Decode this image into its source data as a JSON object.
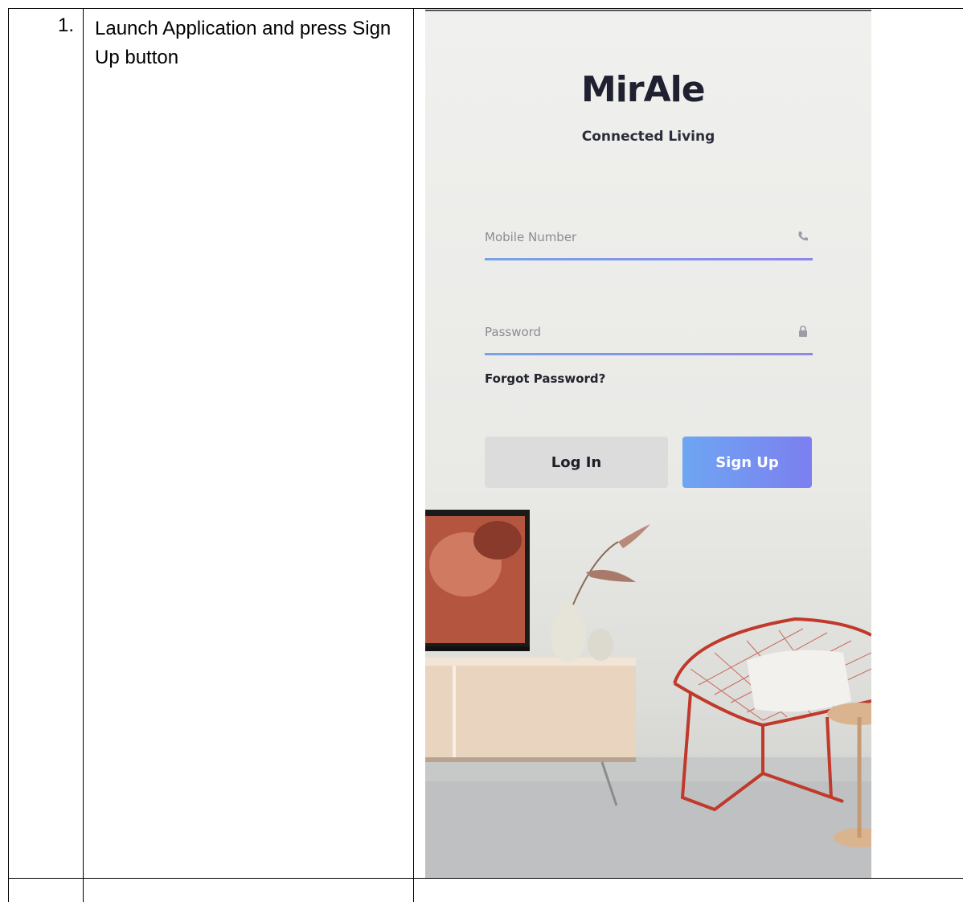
{
  "step": {
    "number": "1.",
    "description": "Launch Application and press Sign Up button"
  },
  "app": {
    "logo_text": "MirAle",
    "tagline": "Connected Living",
    "mobile_placeholder": "Mobile Number",
    "password_placeholder": "Password",
    "forgot_password": "Forgot Password?",
    "login_label": "Log In",
    "signup_label": "Sign Up"
  },
  "colors": {
    "heading_blue": "#2e74b5",
    "signup_gradient_start": "#6ea6f2",
    "signup_gradient_end": "#7c7ff0",
    "login_bg": "#dcdcdc",
    "underline_start": "#78a3e8",
    "underline_end": "#8f86ec",
    "logo_blue": "#2b5fae"
  },
  "icons": {
    "mobile_field": "phone-icon",
    "password_field": "lock-icon"
  }
}
